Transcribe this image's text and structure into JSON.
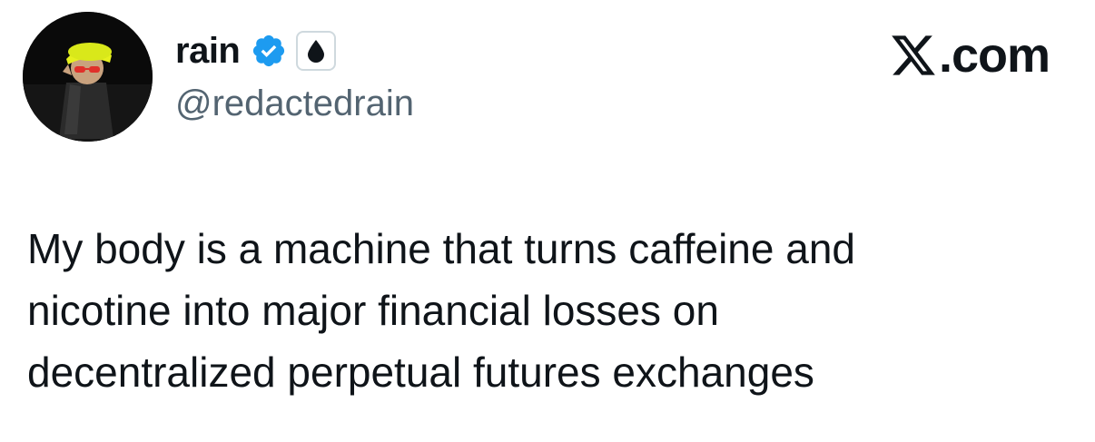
{
  "author": {
    "display_name": "rain",
    "handle": "@redactedrain",
    "verified_icon": "verified-badge-icon",
    "affiliate_icon": "droplet-icon"
  },
  "brand": {
    "label": ".com",
    "logo_icon": "x-logo-icon"
  },
  "tweet": {
    "lines": [
      "My body is a machine that turns caffeine and",
      "nicotine into major financial losses on",
      "decentralized perpetual futures exchanges"
    ]
  },
  "colors": {
    "text": "#0f1419",
    "secondary_text": "#536471",
    "verified_blue": "#1d9bf0",
    "background": "#ffffff"
  }
}
